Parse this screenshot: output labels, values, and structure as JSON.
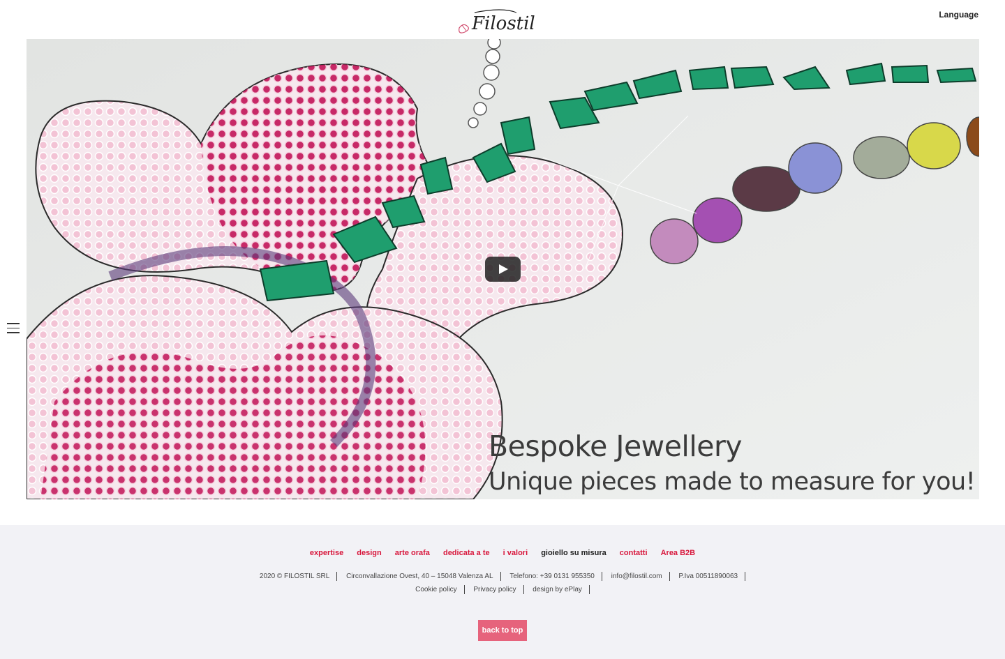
{
  "header": {
    "brand": "Filostil",
    "language_label": "Language"
  },
  "video": {
    "caption_line1": "Bespoke Jewellery",
    "caption_line2": "Unique pieces made to measure for you!"
  },
  "footer": {
    "nav": [
      "expertise",
      "design",
      "arte orafa",
      "dedicata a te",
      "i valori",
      "gioiello su misura",
      "contatti",
      "Area B2B"
    ],
    "active_nav": "gioiello su misura",
    "info_row1": [
      "2020 © FILOSTIL SRL",
      "Circonvallazione Ovest, 40 – 15048 Valenza AL",
      "Telefono: +39 0131 955350",
      "info@filostil.com",
      "P.Iva 00511890063"
    ],
    "info_row2": [
      "Cookie policy",
      "Privacy policy",
      "design by ePlay"
    ],
    "back_to_top": "back to top"
  },
  "colors": {
    "accent": "#d8173c",
    "button": "#e6637c",
    "footer_bg": "#f2f2f6"
  }
}
